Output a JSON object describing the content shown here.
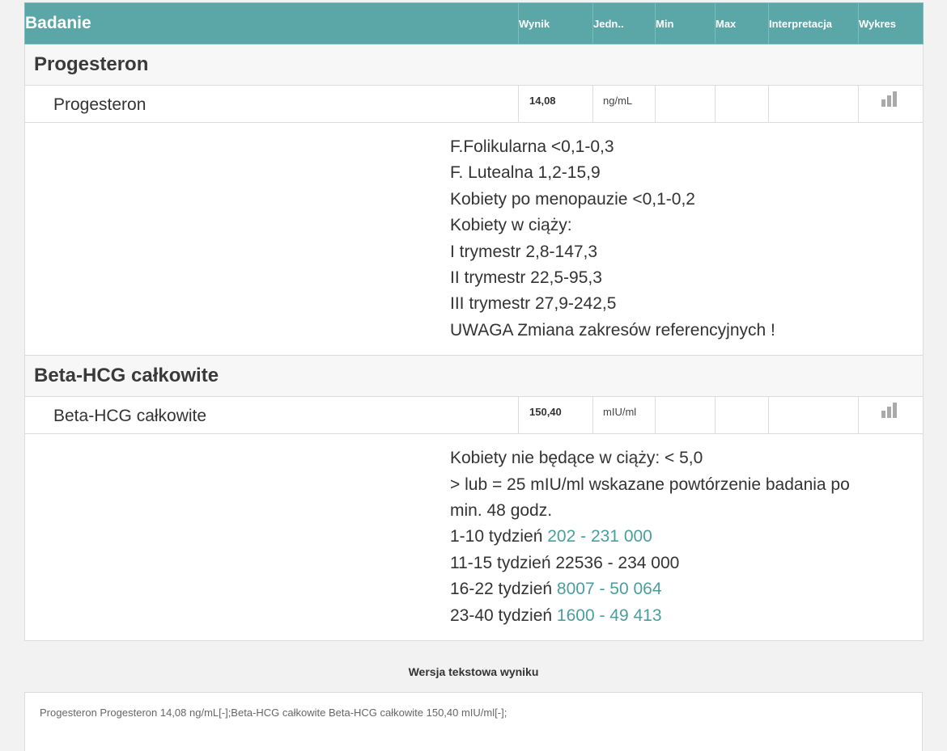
{
  "header": {
    "badanie": "Badanie",
    "wynik": "Wynik",
    "jedn": "Jedn..",
    "min": "Min",
    "max": "Max",
    "interpretacja": "Interpretacja",
    "wykres": "Wykres"
  },
  "groups": [
    {
      "title": "Progesteron",
      "test": {
        "name": "Progesteron",
        "value": "14,08",
        "unit": "ng/mL",
        "min": "",
        "max": "",
        "interpretation": "",
        "chart_icon": "bar-chart-icon"
      },
      "reference": [
        {
          "text": "F.Folikularna <0,1-0,3",
          "accent": ""
        },
        {
          "text": "F. Lutealna 1,2-15,9",
          "accent": ""
        },
        {
          "text": "Kobiety po menopauzie <0,1-0,2",
          "accent": ""
        },
        {
          "text": "Kobiety w ciąży:",
          "accent": ""
        },
        {
          "text": "I trymestr 2,8-147,3",
          "accent": ""
        },
        {
          "text": "II trymestr 22,5-95,3",
          "accent": ""
        },
        {
          "text": "III trymestr 27,9-242,5",
          "accent": ""
        },
        {
          "text": "UWAGA Zmiana zakresów referencyjnych !",
          "accent": ""
        }
      ]
    },
    {
      "title": "Beta-HCG całkowite",
      "test": {
        "name": "Beta-HCG całkowite",
        "value": "150,40",
        "unit": "mIU/ml",
        "min": "",
        "max": "",
        "interpretation": "",
        "chart_icon": "bar-chart-icon"
      },
      "reference": [
        {
          "text": "Kobiety nie będące w ciąży: < 5,0",
          "accent": ""
        },
        {
          "text": "> lub = 25 mIU/ml wskazane powtórzenie badania po",
          "accent": ""
        },
        {
          "text": "min. 48 godz.",
          "accent": ""
        },
        {
          "text": "1-10 tydzień ",
          "accent": "202 - 231 000"
        },
        {
          "text": "11-15 tydzień 22536 - 234 000",
          "accent": ""
        },
        {
          "text": "16-22 tydzień ",
          "accent": "8007 - 50 064"
        },
        {
          "text": "23-40 tydzień ",
          "accent": "1600 - 49 413"
        }
      ]
    }
  ],
  "text_version": {
    "title": "Wersja tekstowa wyniku",
    "content": "Progesteron Progesteron 14,08 ng/mL[-];Beta-HCG całkowite Beta-HCG całkowite 150,40 mIU/ml[-];"
  },
  "colors": {
    "header_bg": "#5ba6a6",
    "accent_text": "#4a9e9e",
    "icon_gray": "#a9a9a9"
  }
}
